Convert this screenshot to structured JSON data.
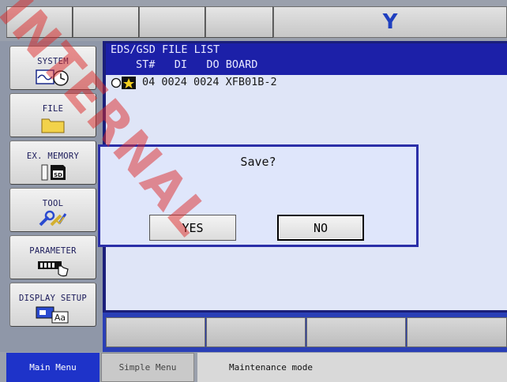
{
  "header": {
    "logo": "Y"
  },
  "sidebar": {
    "items": [
      {
        "label": "SYSTEM",
        "icon": "system-clock-icon"
      },
      {
        "label": "FILE",
        "icon": "folder-icon"
      },
      {
        "label": "EX. MEMORY",
        "icon": "sd-card-icon"
      },
      {
        "label": "TOOL",
        "icon": "tool-icon"
      },
      {
        "label": "PARAMETER",
        "icon": "parameter-hand-icon"
      },
      {
        "label": "DISPLAY SETUP",
        "icon": "display-setup-icon"
      }
    ]
  },
  "list": {
    "title": "EDS/GSD FILE LIST",
    "columns": "ST#   DI   DO BOARD",
    "rows": [
      {
        "text": "04 0024 0024 XFB01B-2"
      }
    ]
  },
  "dialog": {
    "message": "Save?",
    "yes_label": "YES",
    "no_label": "NO"
  },
  "statusbar": {
    "main_menu": "Main Menu",
    "simple_menu": "Simple Menu",
    "mode": "Maintenance mode"
  },
  "watermark": "INTERNAL",
  "colors": {
    "accent": "#1c20a8",
    "logo": "#1f3fbf",
    "watermark": "#dc2828"
  }
}
